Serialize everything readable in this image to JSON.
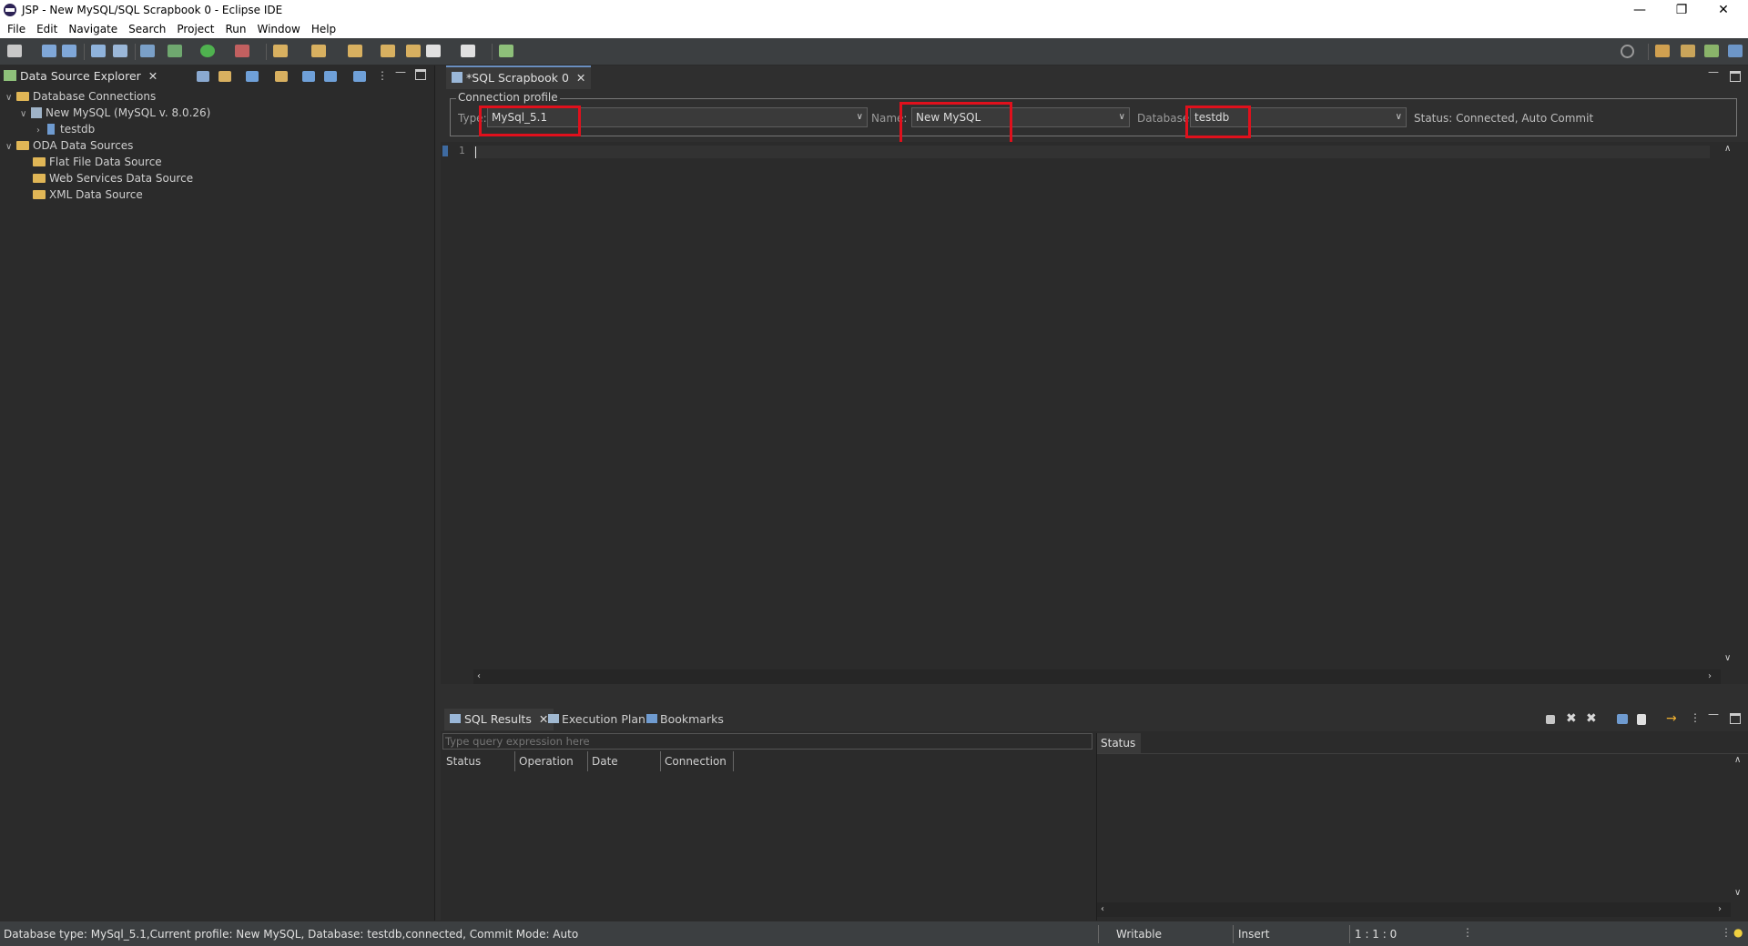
{
  "window": {
    "title": "JSP - New MySQL/SQL Scrapbook 0 - Eclipse IDE",
    "minimize": "—",
    "restore": "❐",
    "close": "✕"
  },
  "menu": [
    "File",
    "Edit",
    "Navigate",
    "Search",
    "Project",
    "Run",
    "Window",
    "Help"
  ],
  "left_view": {
    "tab_label": "Data Source Explorer",
    "tree": [
      {
        "label": "Database Connections",
        "level": 0
      },
      {
        "label": "New MySQL (MySQL v. 8.0.26)",
        "level": 1
      },
      {
        "label": "testdb",
        "level": 2
      },
      {
        "label": "ODA Data Sources",
        "level": 0
      },
      {
        "label": "Flat File Data Source",
        "level": 1
      },
      {
        "label": "Web Services Data Source",
        "level": 1
      },
      {
        "label": "XML Data Source",
        "level": 1
      }
    ]
  },
  "editor": {
    "tab_label": "*SQL Scrapbook 0",
    "profile_legend": "Connection profile",
    "type_label": "Type:",
    "type_value": "MySql_5.1",
    "name_label": "Name:",
    "name_value": "New MySQL",
    "database_label": "Database:",
    "database_value": "testdb",
    "status_text": "Status: Connected, Auto Commit",
    "line_number": "1"
  },
  "results": {
    "tabs": [
      "SQL Results",
      "Execution Plan",
      "Bookmarks"
    ],
    "filter_placeholder": "Type query expression here",
    "columns": [
      "Status",
      "Operation",
      "Date",
      "Connection P"
    ],
    "status_tab": "Status"
  },
  "statusbar": {
    "message": "Database type: MySql_5.1,Current profile: New MySQL, Database: testdb,connected, Commit Mode: Auto",
    "writable": "Writable",
    "insert_mode": "Insert",
    "position": "1 : 1 : 0"
  },
  "colors": {
    "highlight": "#e0101c",
    "background": "#2f2f2f"
  }
}
